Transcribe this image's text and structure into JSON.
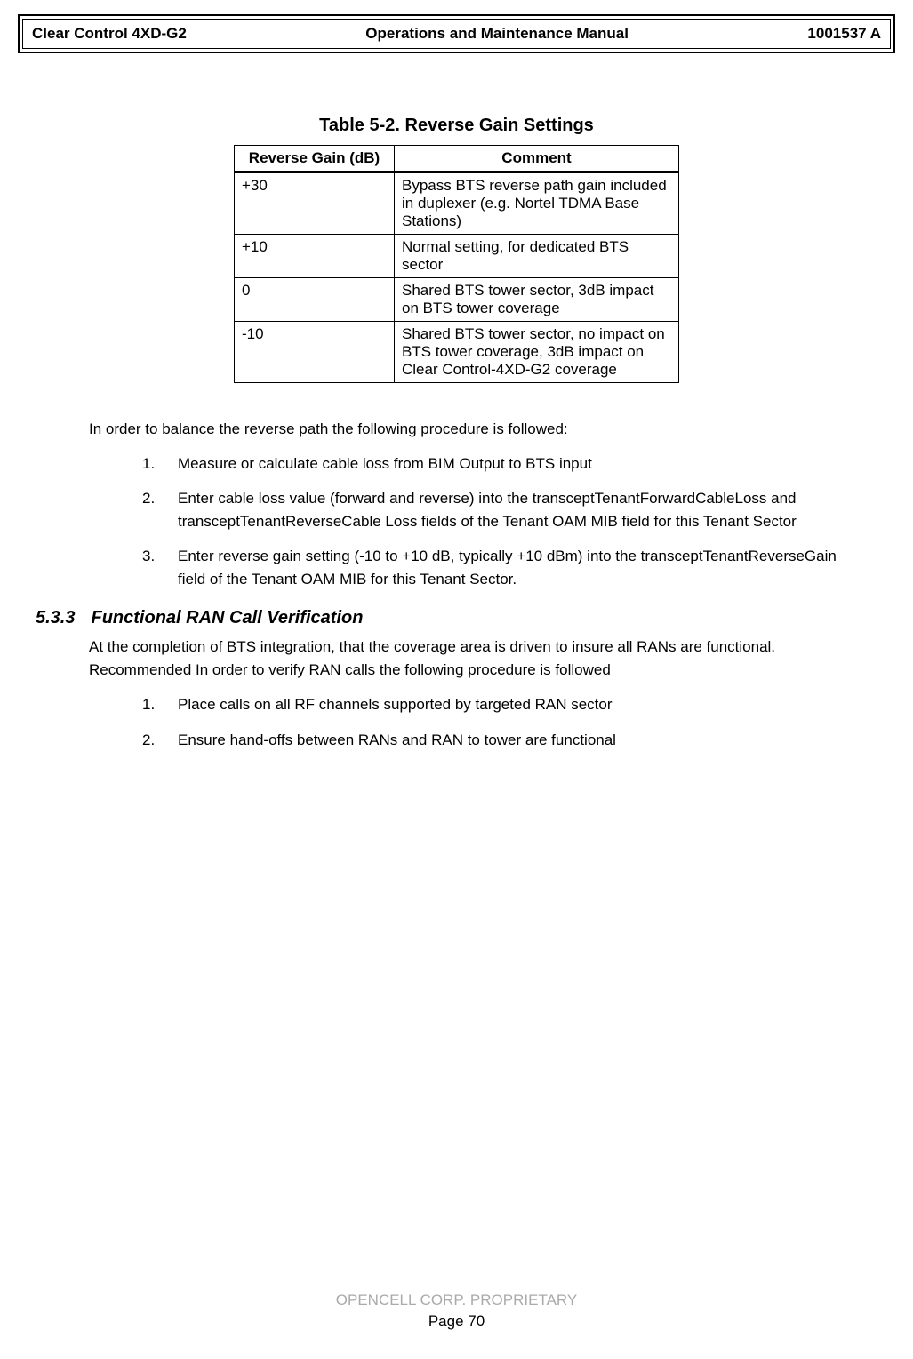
{
  "header": {
    "left": "Clear Control 4XD-G2",
    "center": "Operations and Maintenance Manual",
    "right": "1001537 A"
  },
  "table": {
    "caption": "Table 5-2. Reverse Gain Settings",
    "headers": {
      "gain": "Reverse Gain (dB)",
      "comment": "Comment"
    },
    "rows": [
      {
        "gain": "+30",
        "comment": "Bypass BTS reverse path gain included in duplexer (e.g. Nortel TDMA Base Stations)"
      },
      {
        "gain": "+10",
        "comment": "Normal setting, for dedicated BTS sector"
      },
      {
        "gain": "0",
        "comment": "Shared BTS tower sector, 3dB impact on BTS tower coverage"
      },
      {
        "gain": "-10",
        "comment": "Shared BTS tower sector, no impact on BTS tower coverage, 3dB impact on Clear Control-4XD-G2 coverage"
      }
    ]
  },
  "body": {
    "intro_para": "In order to balance the reverse path the following procedure is followed:",
    "proc1": [
      "Measure or calculate cable loss from BIM Output to BTS input",
      "Enter cable loss value (forward and reverse) into the transceptTenantForwardCableLoss and transceptTenantReverseCable Loss fields of the Tenant OAM MIB field for this Tenant Sector",
      "Enter reverse gain setting (-10 to +10 dB, typically +10 dBm) into the transceptTenantReverseGain field of the Tenant OAM MIB for this Tenant Sector."
    ],
    "section533": {
      "number": "5.3.3",
      "title": "Functional RAN Call Verification",
      "para": "At the completion of BTS integration, that the coverage area is driven to insure all RANs are functional. Recommended In order to verify RAN calls the following procedure is followed",
      "proc2": [
        "Place calls on all RF channels supported by targeted RAN sector",
        "Ensure hand-offs between RANs and RAN to tower are functional"
      ]
    }
  },
  "footer": {
    "line1": "OPENCELL CORP.  PROPRIETARY",
    "line2": "Page 70"
  }
}
